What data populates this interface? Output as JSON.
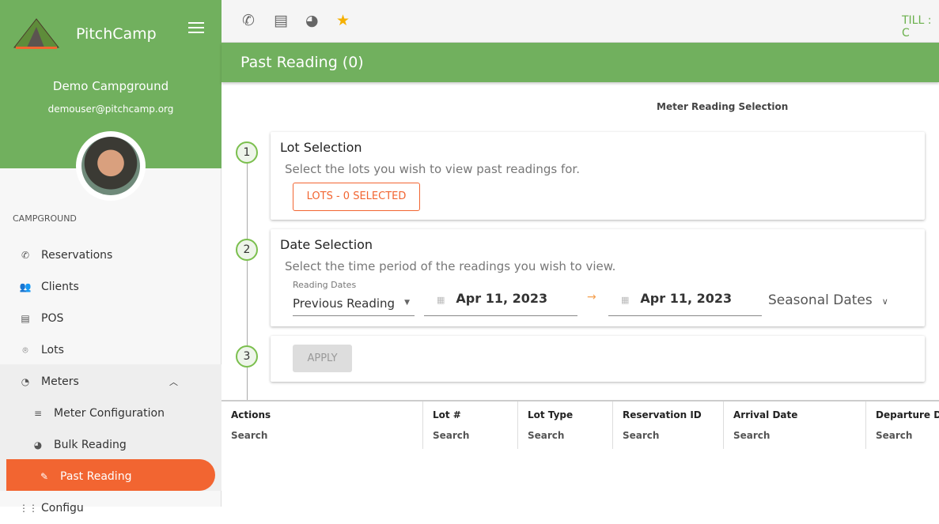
{
  "sidebar": {
    "brand": "PitchCamp",
    "campground": "Demo Campground",
    "email": "demouser@pitchcamp.org",
    "section": "CAMPGROUND",
    "items": [
      {
        "label": "Reservations",
        "icon": "phone-icon"
      },
      {
        "label": "Clients",
        "icon": "people-icon"
      },
      {
        "label": "POS",
        "icon": "store-icon"
      },
      {
        "label": "Lots",
        "icon": "pin-icon"
      },
      {
        "label": "Meters",
        "icon": "meter-icon"
      },
      {
        "label": "Meter Configuration",
        "icon": "list-check-icon"
      },
      {
        "label": "Bulk Reading",
        "icon": "pie-icon"
      },
      {
        "label": "Past Reading",
        "icon": "pencil-icon"
      },
      {
        "label": "Configu",
        "icon": "grid-icon"
      }
    ]
  },
  "topbar": {
    "till": "TILL : C"
  },
  "page": {
    "title": "Past Reading (0)",
    "section_title": "Meter Reading Selection"
  },
  "steps": [
    {
      "num": "1",
      "title": "Lot Selection",
      "desc": "Select the lots you wish to view past readings for.",
      "button": "LOTS - 0 SELECTED"
    },
    {
      "num": "2",
      "title": "Date Selection",
      "desc": "Select the time period of the readings you wish to view.",
      "reading_label": "Reading Dates",
      "reading_value": "Previous Reading",
      "start": "Apr 11, 2023",
      "end": "Apr 11, 2023",
      "seasonal": "Seasonal Dates"
    },
    {
      "num": "3",
      "button": "APPLY"
    }
  ],
  "table": {
    "columns": [
      "Actions",
      "Lot #",
      "Lot Type",
      "Reservation ID",
      "Arrival Date",
      "Departure Date"
    ],
    "search": "Search"
  },
  "colors": {
    "green": "#71b05e",
    "orange": "#f26531"
  }
}
